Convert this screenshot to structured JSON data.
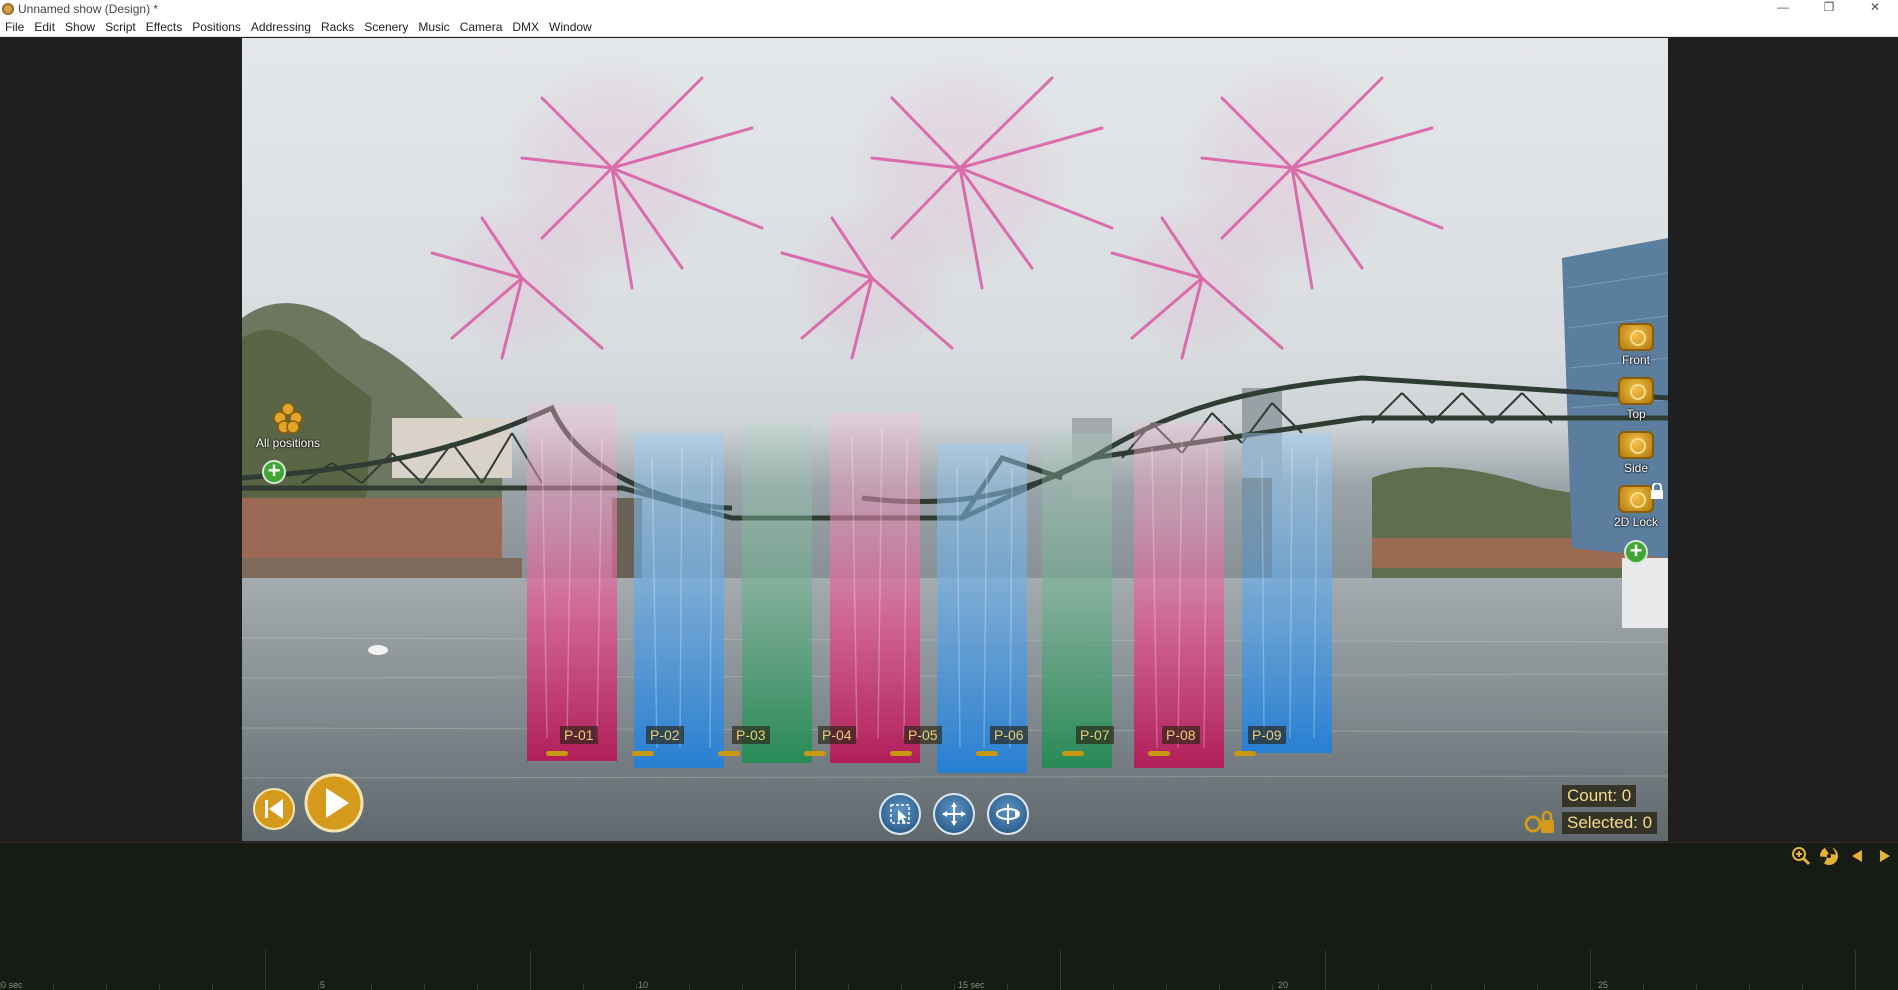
{
  "window": {
    "title": "Unnamed show (Design) *",
    "controls": [
      "—",
      "❐",
      "✕"
    ]
  },
  "menu": [
    "File",
    "Edit",
    "Show",
    "Script",
    "Effects",
    "Positions",
    "Addressing",
    "Racks",
    "Scenery",
    "Music",
    "Camera",
    "DMX",
    "Window"
  ],
  "viewport": {
    "all_positions_label": "All positions",
    "positions": [
      "P-01",
      "P-02",
      "P-03",
      "P-04",
      "P-05",
      "P-06",
      "P-07",
      "P-08",
      "P-09"
    ],
    "cameras": [
      {
        "label": "Front",
        "icon": "camera-icon"
      },
      {
        "label": "Top",
        "icon": "camera-icon"
      },
      {
        "label": "Side",
        "icon": "camera-icon"
      },
      {
        "label": "2D Lock",
        "icon": "camera-lock-icon"
      }
    ],
    "status": {
      "count": "Count: 0",
      "selected": "Selected: 0"
    }
  },
  "timeline": {
    "tick_labels": [
      "0 sec",
      "5",
      "10",
      "15 sec",
      "20",
      "25"
    ]
  },
  "colors": {
    "gold": "#c8980f",
    "blue_tool": "#2f6ea3",
    "add_green": "#3fa535",
    "pink_fountain": "#d0286a",
    "blue_fountain": "#2a8fe0",
    "green_fountain": "#1e9a5a"
  }
}
